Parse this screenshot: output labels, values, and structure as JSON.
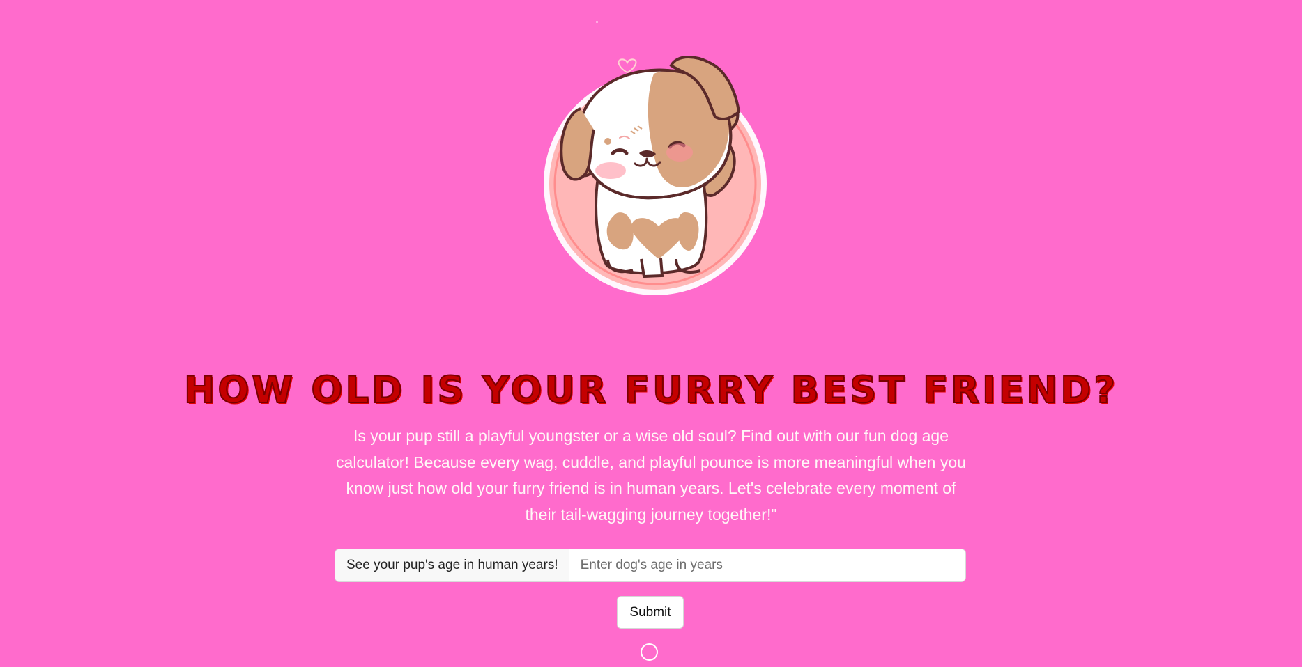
{
  "hero": {
    "icon": "cute-puppy-illustration"
  },
  "main": {
    "title": "How old is your furry best friend?",
    "intro": "Is your pup still a playful youngster or a wise old soul? Find out with our fun dog age calculator! Because every wag, cuddle, and playful pounce is more meaningful when you know just how old your furry friend is in human years. Let's celebrate every moment of their tail-wagging journey together!\""
  },
  "form": {
    "label": "See your pup's age in human years!",
    "input_value": "",
    "input_placeholder": "Enter dog's age in years",
    "submit_label": "Submit"
  },
  "status": {
    "icon": "loading-circle-icon"
  },
  "colors": {
    "background": "#ff6bcc",
    "title": "#c40000",
    "intro_text": "#fff7f7"
  }
}
